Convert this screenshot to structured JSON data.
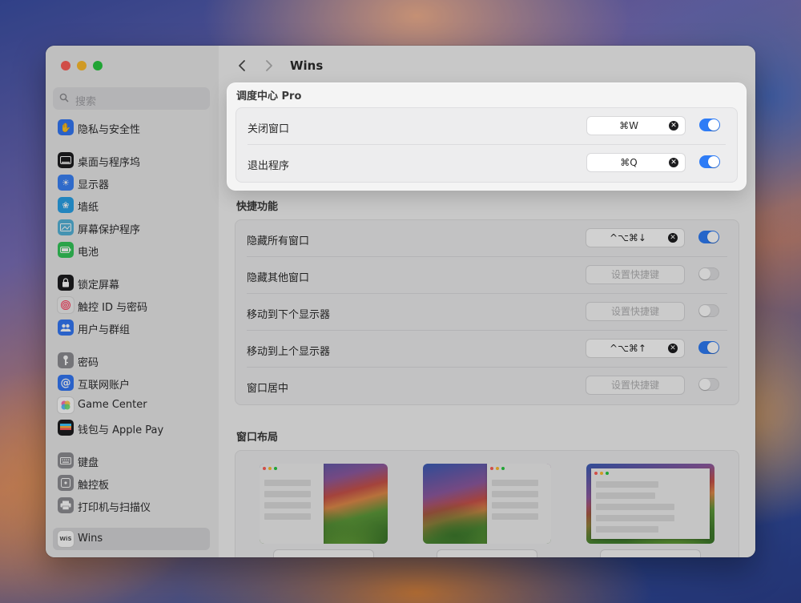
{
  "window": {
    "title": "Wins"
  },
  "sidebar": {
    "search_placeholder": "搜索",
    "items": [
      {
        "label": "隐私与安全性",
        "icon": "hand-icon",
        "color": "#3478f6"
      },
      {
        "label": "桌面与程序坞",
        "icon": "dock-icon",
        "color": "#1d1d1f"
      },
      {
        "label": "显示器",
        "icon": "sun-icon",
        "color": "#3a82f7"
      },
      {
        "label": "墙纸",
        "icon": "flower-icon",
        "color": "#2aa3e8"
      },
      {
        "label": "屏幕保护程序",
        "icon": "screensaver-icon",
        "color": "#55b4d9"
      },
      {
        "label": "电池",
        "icon": "battery-icon",
        "color": "#34c759"
      },
      {
        "label": "锁定屏幕",
        "icon": "lock-icon",
        "color": "#1d1d1f"
      },
      {
        "label": "触控 ID 与密码",
        "icon": "fingerprint-icon",
        "color": "#f0f0f0"
      },
      {
        "label": "用户与群组",
        "icon": "users-icon",
        "color": "#3478f6"
      },
      {
        "label": "密码",
        "icon": "key-icon",
        "color": "#8e8e93"
      },
      {
        "label": "互联网账户",
        "icon": "at-icon",
        "color": "#3478f6"
      },
      {
        "label": "Game Center",
        "icon": "game-center-icon",
        "color": "#ffffff"
      },
      {
        "label": "钱包与 Apple Pay",
        "icon": "wallet-icon",
        "color": "#1d1d1f"
      },
      {
        "label": "键盘",
        "icon": "keyboard-icon",
        "color": "#8e8e93"
      },
      {
        "label": "触控板",
        "icon": "trackpad-icon",
        "color": "#8e8e93"
      },
      {
        "label": "打印机与扫描仪",
        "icon": "printer-icon",
        "color": "#8e8e93"
      },
      {
        "label": "Wins",
        "icon": "wins-app-icon",
        "color": "#ffffff",
        "wins_badge": "WiS"
      }
    ]
  },
  "toolbar": {
    "back": "‹",
    "forward": "›"
  },
  "mission_control": {
    "title": "调度中心 Pro",
    "rows": [
      {
        "label": "关闭窗口",
        "shortcut": "⌘W",
        "enabled": true
      },
      {
        "label": "退出程序",
        "shortcut": "⌘Q",
        "enabled": true
      }
    ]
  },
  "shortcuts": {
    "title": "快捷功能",
    "rows": [
      {
        "label": "隐藏所有窗口",
        "shortcut": "^⌥⌘↓",
        "enabled": true
      },
      {
        "label": "隐藏其他窗口",
        "shortcut": "设置快捷键",
        "enabled": false
      },
      {
        "label": "移动到下个显示器",
        "shortcut": "设置快捷键",
        "enabled": false
      },
      {
        "label": "移动到上个显示器",
        "shortcut": "^⌥⌘↑",
        "enabled": true
      },
      {
        "label": "窗口居中",
        "shortcut": "设置快捷键",
        "enabled": false
      }
    ]
  },
  "layouts": {
    "title": "窗口布局"
  },
  "colors": {
    "accent": "#2e7cf6"
  }
}
